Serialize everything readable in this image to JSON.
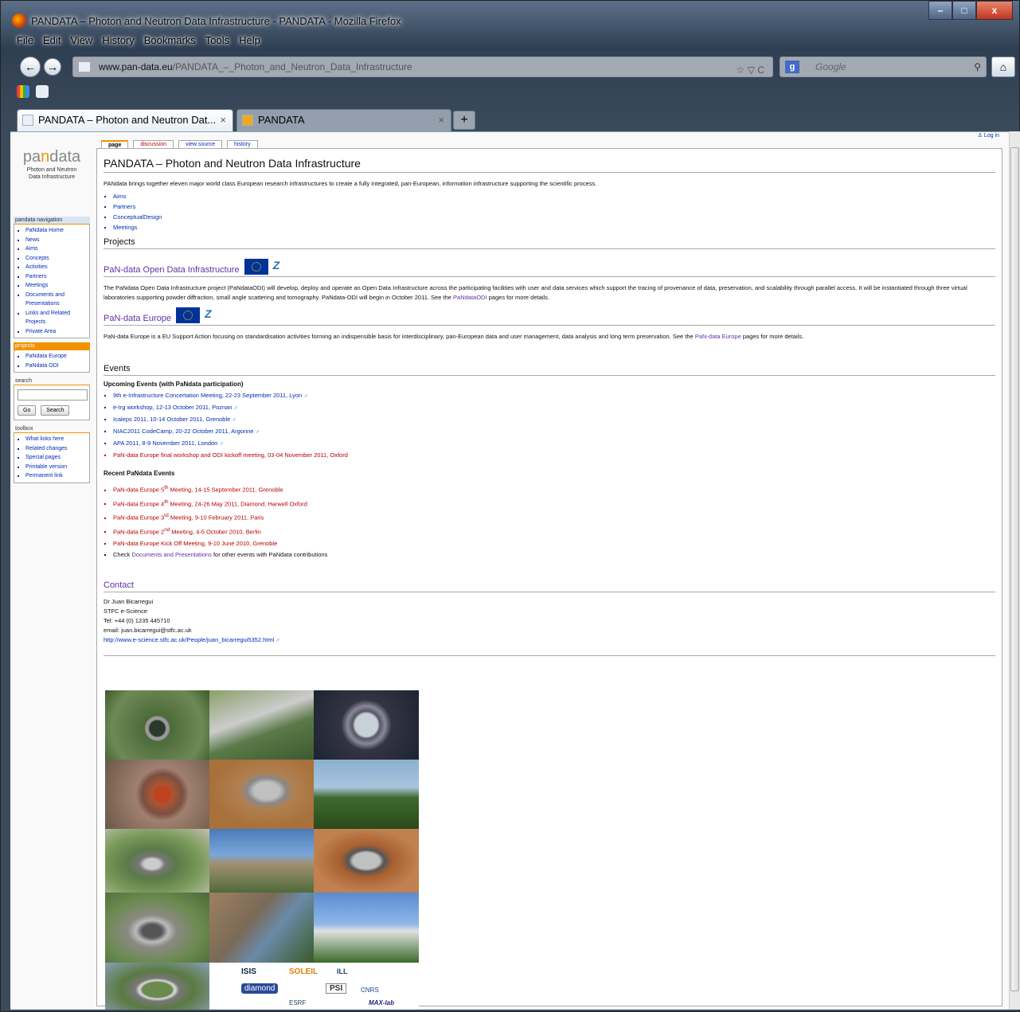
{
  "window": {
    "title": "PANDATA – Photon and Neutron Data Infrastructure - PANDATA - Mozilla Firefox",
    "min": "–",
    "max": "□",
    "close": "x"
  },
  "menu": [
    "File",
    "Edit",
    "View",
    "History",
    "Bookmarks",
    "Tools",
    "Help"
  ],
  "nav": {
    "back": "←",
    "forward": "→",
    "url_domain": "www.pan-data.eu",
    "url_path": "/PANDATA_–_Photon_and_Neutron_Data_Infrastructure",
    "url_controls": "☆ ▽ C",
    "search_placeholder": "Google",
    "search_engine": "g",
    "search_icon": "⚲",
    "home": "⌂"
  },
  "tabs": [
    {
      "label": "PANDATA – Photon and Neutron Dat...",
      "close": "×"
    },
    {
      "label": "PANDATA",
      "close": "×"
    }
  ],
  "newtab": "+",
  "page": {
    "tabs": [
      "page",
      "discussion",
      "view source",
      "history"
    ],
    "login": "Log in",
    "logo_word": {
      "pa": "pa",
      "n": "n",
      "data": "data"
    },
    "logo_sub1": "Photon and Neutron",
    "logo_sub2": "Data Infrastructure",
    "title": "PANDATA – Photon and Neutron Data Infrastructure",
    "intro": "PANdata brings together eleven major world class European research infrastructures to create a fully integrated, pan-European, information infrastructure supporting the scientific process.",
    "intro_links": [
      "Aims",
      "Partners",
      "ConceptualDesign",
      "Meetings"
    ],
    "projects_heading": "Projects",
    "odi_heading": "PaN-data Open Data Infrastructure",
    "odi_text_a": "The PaNdata Open Data Infrastructure project (PaNdataODI) will develop, deploy and operate an Open Data Infrastructure across the participating facilities with user and data services which support the tracing of provenance of data, preservation, and scalability through parallel access. It will be instantiated through three virtual laboratories supporting powder diffraction, small angle scattering and tomography. PaNdata-ODI will begin in October 2011. See the",
    "odi_link": "PaNdataODI",
    "odi_text_b": "pages for more details.",
    "europe_heading": "PaN-data Europe",
    "europe_text_a": "PaN-data Europe is a EU Support Action focusing on standardisation activities forming an indispensible basis for interdisciplinary, pan-European data and user management, data analysis and long term preservation. See the",
    "europe_link": "PaN-data Europe",
    "europe_text_b": "pages for more details.",
    "events_heading": "Events",
    "upcoming_heading": "Upcoming Events (with PaNdata participation)",
    "upcoming": [
      "9th e-Infrastructure Concertation Meeting, 22-23 September 2011, Lyon",
      "e-Irg workshop, 12-13 October 2011, Poznan",
      "Icaleps 2011, 10-14 October 2011, Grenoble",
      "NIAC2011 CodeCamp, 20-22 October 2011, Argonne",
      "APA 2011, 8-9 November 2011, London",
      "PaN-data Europe final workshop and ODI kickoff meeting, 03-04 November 2011, Oxford"
    ],
    "recent_heading": "Recent PaNdata Events",
    "recent": [
      {
        "a": "PaN-data Europe 5",
        "sup": "th",
        "b": " Meeting, 14-15 September 2011, Grenoble"
      },
      {
        "a": "PaN-data Europe 4",
        "sup": "th",
        "b": " Meeting, 24-26 May 2011, Diamond, Harwell Oxford"
      },
      {
        "a": "PaN-data Europe 3",
        "sup": "rd",
        "b": " Meeting, 9-10 February 2011, Paris"
      },
      {
        "a": "PaN-data Europe 2",
        "sup": "nd",
        "b": " Meeting, 4-5 October 2010, Berlin"
      },
      {
        "a": "PaN-data Europe Kick Off Meeting, 9-10 June 2010, Grenoble",
        "sup": "",
        "b": ""
      }
    ],
    "check_a": "Check",
    "check_link": "Documents and Presentations",
    "check_b": "for other events with PaNdata contributions",
    "contact_heading": "Contact",
    "contact_lines": [
      "Dr Juan Bicarregui",
      "STFC e-Science",
      "Tel: +44 (0) 1235 445710",
      "email: juan.bicarregui@stfc.ac.uk"
    ],
    "contact_link": "http://www.e-science.stfc.ac.uk/People/juan_bicarregui5352.html",
    "ext_icon": "⇗",
    "login_icon": "♙",
    "logos": [
      "ISIS",
      "SOLEIL",
      "diamond",
      "PSI",
      "ILL",
      "ESRF",
      "CNRS",
      "MAX-lab"
    ]
  },
  "sidebar": {
    "nav_heading": "pandata navigation",
    "nav_items": [
      "PaNdata Home",
      "News",
      "Aims",
      "Concepts",
      "Activities",
      "Partners",
      "Meetings",
      "Documents and Presentations",
      "Links and Related Projects",
      "Private Area"
    ],
    "projects_heading": "projects",
    "projects_items": [
      "PaNdata Europe",
      "PaNdata ODI"
    ],
    "search_heading": "search",
    "go": "Go",
    "search_btn": "Search",
    "toolbox_heading": "toolbox",
    "toolbox_items": [
      "What links here",
      "Related changes",
      "Special pages",
      "Printable version",
      "Permanent link"
    ]
  },
  "colors": {
    "accent": "#f39200",
    "link": "#002bb8",
    "visited": "#6131a6",
    "new": "#ba0000"
  }
}
